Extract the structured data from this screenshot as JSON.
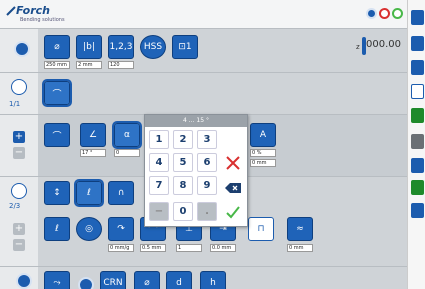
{
  "header": {
    "logo_text": "Forch",
    "logo_sub": "Bending solutions"
  },
  "top_row": {
    "values": [
      "250 mm",
      "2 mm",
      "120"
    ],
    "readout": "000.00",
    "readout_prefix": "z"
  },
  "row1": {
    "counter": "1/1"
  },
  "row2": {
    "values": [
      "17 °",
      "0",
      "0 %",
      "0 mm"
    ]
  },
  "row3": {
    "counter": "2/3",
    "values": [
      "0 mm/g",
      "0.5 mm",
      "1",
      "0.0 mm",
      "0 mm"
    ]
  },
  "keypad": {
    "title": "4 ... 15 °",
    "keys": [
      "1",
      "2",
      "3",
      "4",
      "5",
      "6",
      "7",
      "8",
      "9",
      "−",
      "0",
      "."
    ]
  },
  "colors": {
    "accent": "#1c5cae",
    "ok": "#48b848",
    "cancel": "#d93030"
  }
}
